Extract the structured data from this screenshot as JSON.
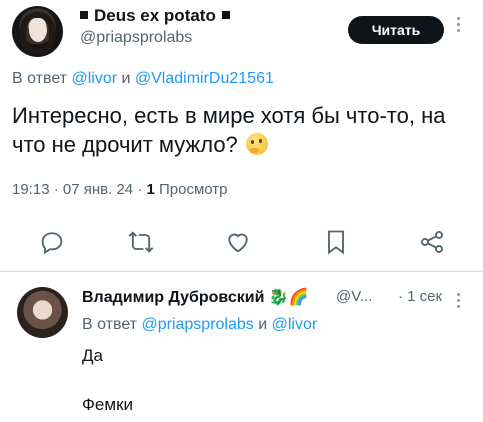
{
  "tweet": {
    "author_name": "Deus ex potato",
    "author_handle": "@priapsprolabs",
    "follow_label": "Читать",
    "reply_prefix": "В ответ",
    "reply_user1": "@livor",
    "reply_and": "и",
    "reply_user2": "@VladimirDu21561",
    "text": "Интересно, есть в мире хотя бы что-то, на что не дрочит мужло?",
    "emoji": "thinking-face-icon",
    "time": "19:13",
    "date": "07 янв. 24",
    "views_count": "1",
    "views_label": "Просмотр",
    "actions": [
      "reply-icon",
      "retweet-icon",
      "like-icon",
      "bookmark-icon",
      "share-icon"
    ]
  },
  "reply": {
    "author_name": "Владимир Дубровский",
    "emojis": "🐉🌈",
    "author_handle": "@V...",
    "time": "1 сек",
    "reply_prefix": "В ответ",
    "reply_user1": "@priapsprolabs",
    "reply_and": "и",
    "reply_user2": "@livor",
    "line1": "Да",
    "line2": "Фемки"
  },
  "colors": {
    "link": "#1d9bf0",
    "text": "#0f1419",
    "muted": "#536471",
    "icon": "#536471"
  }
}
